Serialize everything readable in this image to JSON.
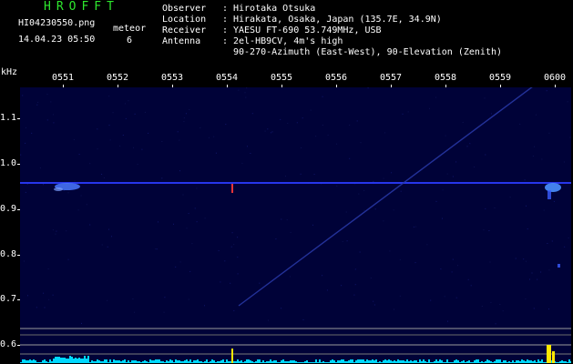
{
  "brand": "HROFFT",
  "file_name": "HI04230550.png",
  "timestamp": "14.04.23 05:50",
  "meteor_label": "meteor",
  "meteor_count": "6",
  "info": [
    {
      "key": "Observer",
      "value": "Hirotaka Otsuka"
    },
    {
      "key": "Location",
      "value": "Hirakata, Osaka, Japan (135.7E, 34.9N)"
    },
    {
      "key": "Receiver",
      "value": "YAESU FT-690 53.749MHz, USB"
    },
    {
      "key": "Antenna",
      "value": "2el-HB9CV, 4m's high"
    },
    {
      "key": "",
      "value": "90-270-Azimuth (East-West), 90-Elevation (Zenith)"
    }
  ],
  "axis_unit": "kHz",
  "y_ticks": [
    "1.1",
    "1.0",
    "0.9",
    "0.8",
    "0.7",
    "0.6"
  ],
  "x_ticks": [
    "0551",
    "0552",
    "0553",
    "0554",
    "0555",
    "0556",
    "0557",
    "0558",
    "0559",
    "0600"
  ],
  "colors": {
    "background": "#000238",
    "carrier": "#2c3cff",
    "echo": "#5f8cff",
    "spectrum_cyan": "#00d8ff",
    "spectrum_yellow": "#ffe800",
    "brand_green": "#2ee82e"
  }
}
